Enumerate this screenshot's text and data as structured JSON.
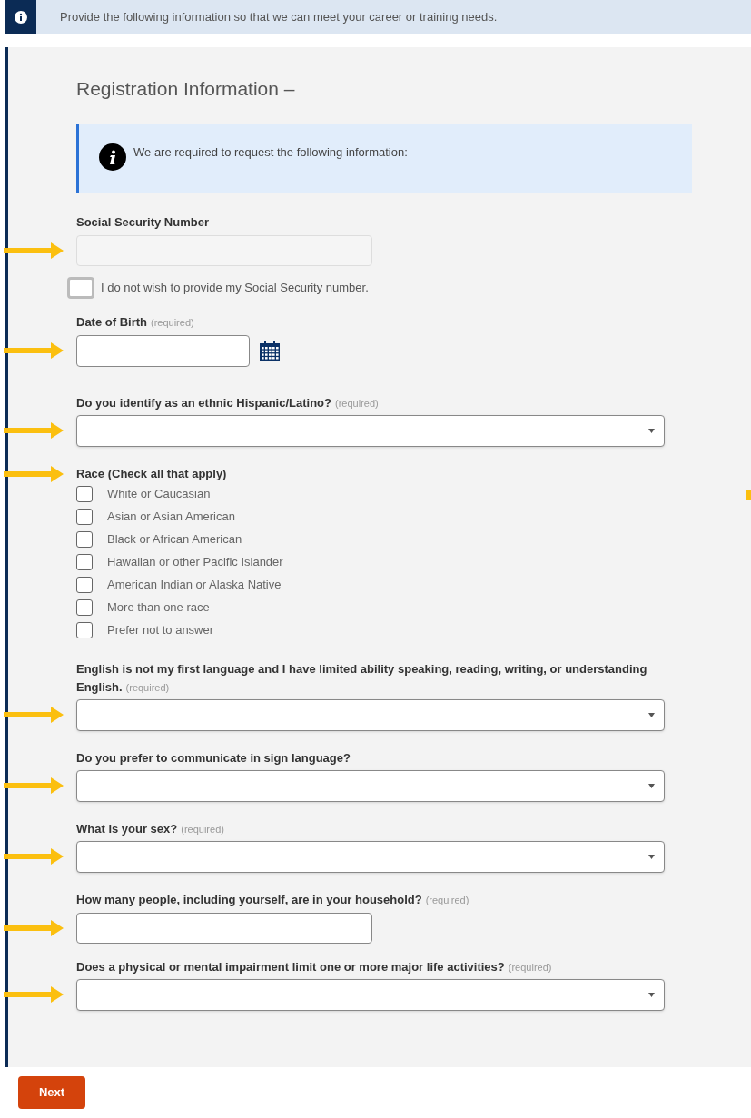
{
  "banner": {
    "text": "Provide the following information so that we can meet your career or training needs."
  },
  "form": {
    "title": "Registration Information –",
    "notice": "We are required to request the following information:",
    "fields": [
      {
        "kind": "text",
        "label": "Social Security Number",
        "disabled": true,
        "arrow": true,
        "opt_out": {
          "label": "I do not wish to provide my Social Security number.",
          "checked": false
        }
      },
      {
        "kind": "date",
        "label": "Date of Birth",
        "hint": "(required)",
        "arrow": true
      },
      {
        "kind": "select",
        "label": "Do you identify as an ethnic Hispanic/Latino?",
        "hint": "(required)",
        "arrow": true
      },
      {
        "kind": "checkboxes",
        "label": "Race (Check all that apply)",
        "arrow": true,
        "options": [
          {
            "label": "White or Caucasian",
            "checked": false
          },
          {
            "label": "Asian or Asian American",
            "checked": false
          },
          {
            "label": "Black or African American",
            "checked": false
          },
          {
            "label": "Hawaiian or other Pacific Islander",
            "checked": false
          },
          {
            "label": "American Indian or Alaska Native",
            "checked": false
          },
          {
            "label": "More than one race",
            "checked": false
          },
          {
            "label": "Prefer not to answer",
            "checked": false
          }
        ]
      },
      {
        "kind": "select",
        "label": "English is not my first language and I have limited ability speaking, reading, writing, or understanding English.",
        "hint": "(required)",
        "arrow": true
      },
      {
        "kind": "select",
        "label": "Do you prefer to communicate in sign language?",
        "arrow": true
      },
      {
        "kind": "select",
        "label": "What is your sex?",
        "hint": "(required)",
        "arrow": true
      },
      {
        "kind": "text",
        "label": "How many people, including yourself, are in your household?",
        "hint": "(required)",
        "disabled": false,
        "arrow": true
      },
      {
        "kind": "select",
        "label": "Does a physical or mental impairment limit one or more major life activities?",
        "hint": "(required)",
        "arrow": true
      }
    ]
  },
  "footer": {
    "button": "Next"
  }
}
